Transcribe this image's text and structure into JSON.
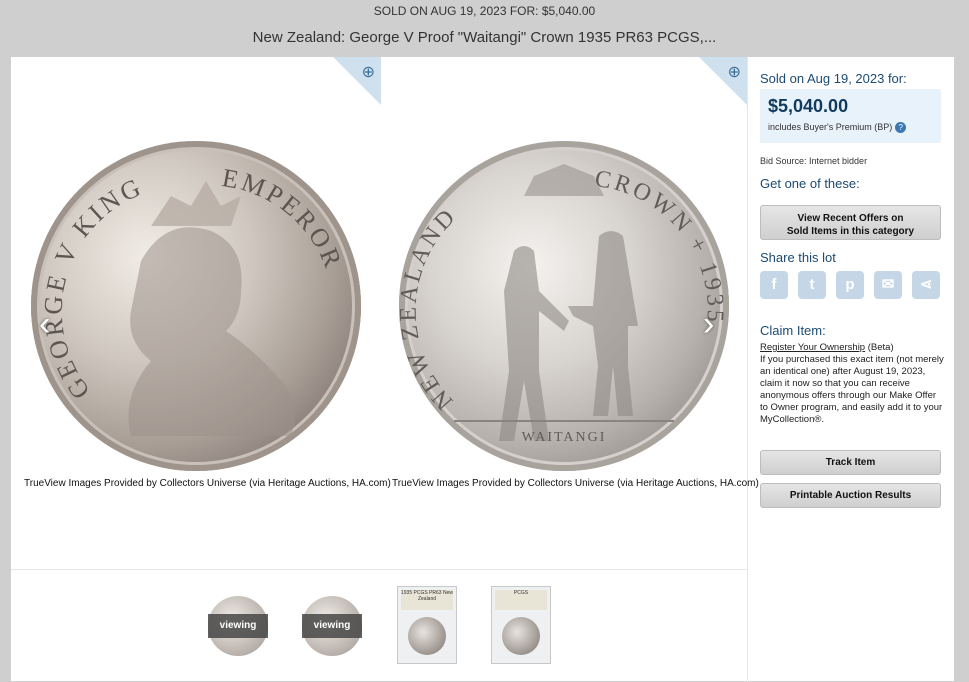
{
  "banner": "SOLD ON AUG 19, 2023 FOR: $5,040.00",
  "title": "New Zealand: George V Proof \"Waitangi\" Crown 1935 PR63 PCGS,...",
  "viewer": {
    "left_caption": "TrueView Images Provided by Collectors Universe (via Heritage Auctions, HA.com)",
    "right_caption": "TrueView Images Provided by Collectors Universe (via Heritage Auctions, HA.com)",
    "obverse_legend_left": "GEORGE V KING",
    "obverse_legend_right": "EMPEROR",
    "reverse_legend_left": "NEW ZEALAND",
    "reverse_legend_right": "CROWN + 1935",
    "reverse_exergue": "WAITANGI",
    "prev_arrow": "‹",
    "next_arrow": "›",
    "zoom_icon": "⊕"
  },
  "thumbnails": [
    {
      "label": "viewing"
    },
    {
      "label": "viewing"
    },
    {
      "slab_text": "1935 PCGS PR63 New Zealand"
    },
    {
      "slab_text": "PCGS"
    }
  ],
  "sidebar": {
    "sold_heading": "Sold on Aug 19, 2023 for:",
    "price": "$5,040.00",
    "bp_note": "includes Buyer's Premium (BP)",
    "bp_help": "?",
    "bid_source": "Bid Source: Internet bidder",
    "get_one": "Get one of these:",
    "offers_button_line1": "View Recent Offers on",
    "offers_button_line2": "Sold Items in this category",
    "share_heading": "Share this lot",
    "share_icons": [
      "facebook-icon",
      "twitter-icon",
      "pinterest-icon",
      "email-icon",
      "share-icon"
    ],
    "claim_heading": "Claim Item:",
    "claim_link": "Register Your Ownership",
    "claim_beta": " (Beta)",
    "claim_text": "If you purchased this exact item (not merely an identical one) after August 19, 2023, claim it now so that you can receive anonymous offers through our Make Offer to Owner program, and easily add it to your MyCollection®.",
    "track_button": "Track Item",
    "print_button": "Printable Auction Results"
  },
  "colors": {
    "accent": "#1c4b73",
    "price_box": "#e8f2fb",
    "page_bg": "#cfcfcf"
  }
}
